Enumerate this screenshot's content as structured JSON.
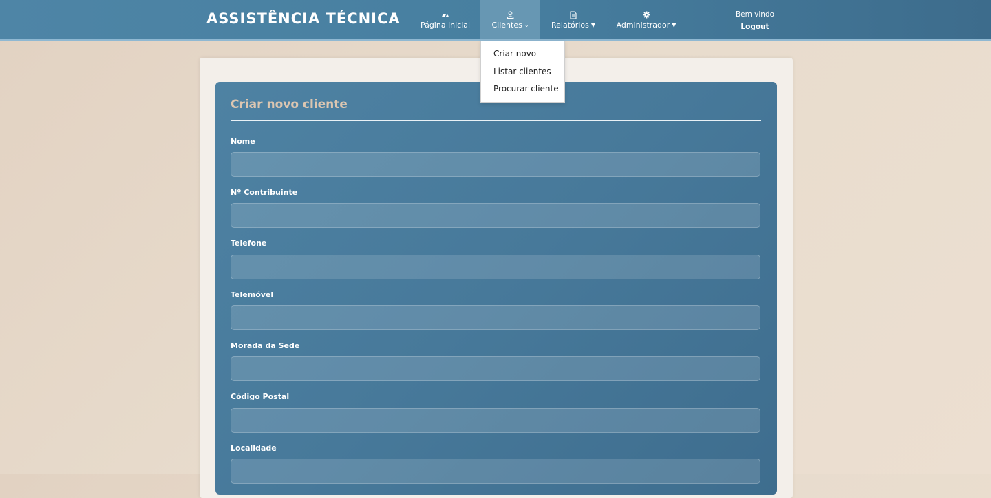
{
  "brand": "ASSISTÊNCIA TÉCNICA",
  "nav": [
    {
      "label": "Página inicial",
      "icon": "dashboard-icon",
      "dropdown": false
    },
    {
      "label": "Clientes",
      "icon": "user-icon",
      "dropdown": true,
      "active": true
    },
    {
      "label": "Relatórios",
      "icon": "document-icon",
      "dropdown": true
    },
    {
      "label": "Administrador",
      "icon": "gear-icon",
      "dropdown": true
    }
  ],
  "welcome": {
    "text": "Bem vindo",
    "logout": "Logout"
  },
  "dropdown": {
    "items": [
      "Criar novo",
      "Listar clientes",
      "Procurar cliente"
    ]
  },
  "form": {
    "title": "Criar novo cliente",
    "fields": [
      {
        "label": "Nome",
        "value": ""
      },
      {
        "label": "Nº Contribuinte",
        "value": ""
      },
      {
        "label": "Telefone",
        "value": ""
      },
      {
        "label": "Telemóvel",
        "value": ""
      },
      {
        "label": "Morada da Sede",
        "value": ""
      },
      {
        "label": "Código Postal",
        "value": ""
      },
      {
        "label": "Localidade",
        "value": ""
      }
    ]
  },
  "colors": {
    "navbar": "#477fa0",
    "nav_active": "#6797b3",
    "panel": "#47799a",
    "title": "#dcc6b1",
    "page_bg": "#e8dccd"
  }
}
